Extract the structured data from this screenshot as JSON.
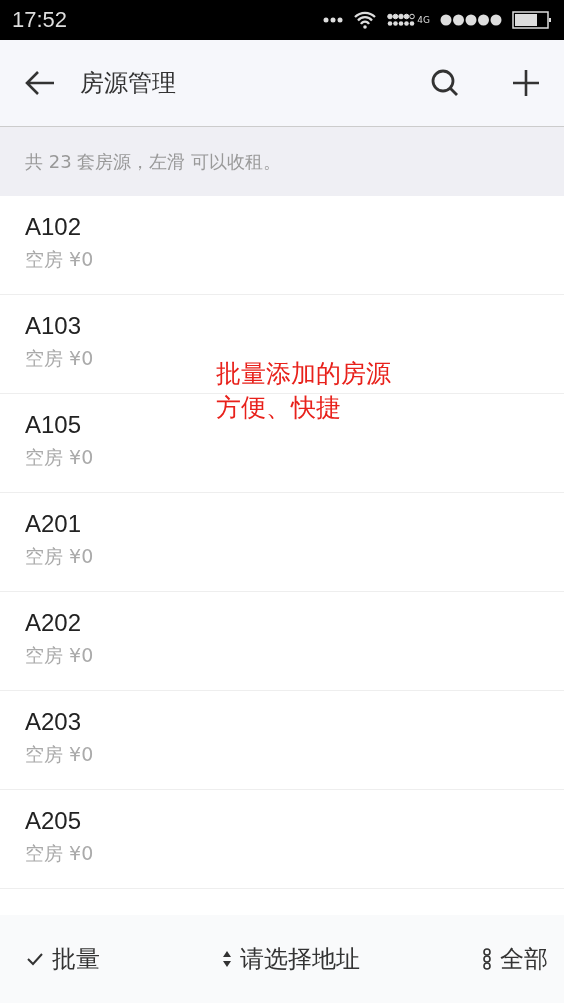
{
  "status_bar": {
    "time": "17:52",
    "network": "4G"
  },
  "header": {
    "title": "房源管理"
  },
  "notice": "共 23 套房源，左滑 可以收租。",
  "rooms": [
    {
      "name": "A102",
      "status": "空房 ¥0"
    },
    {
      "name": "A103",
      "status": "空房 ¥0"
    },
    {
      "name": "A105",
      "status": "空房 ¥0"
    },
    {
      "name": "A201",
      "status": "空房 ¥0"
    },
    {
      "name": "A202",
      "status": "空房 ¥0"
    },
    {
      "name": "A203",
      "status": "空房 ¥0"
    },
    {
      "name": "A205",
      "status": "空房 ¥0"
    }
  ],
  "annotation": [
    "批量添加的房源",
    "方便、快捷"
  ],
  "bottom_bar": [
    {
      "kind": "check",
      "label": "批量"
    },
    {
      "kind": "sort",
      "label": "请选择地址"
    },
    {
      "kind": "filter",
      "label": "全部"
    }
  ]
}
